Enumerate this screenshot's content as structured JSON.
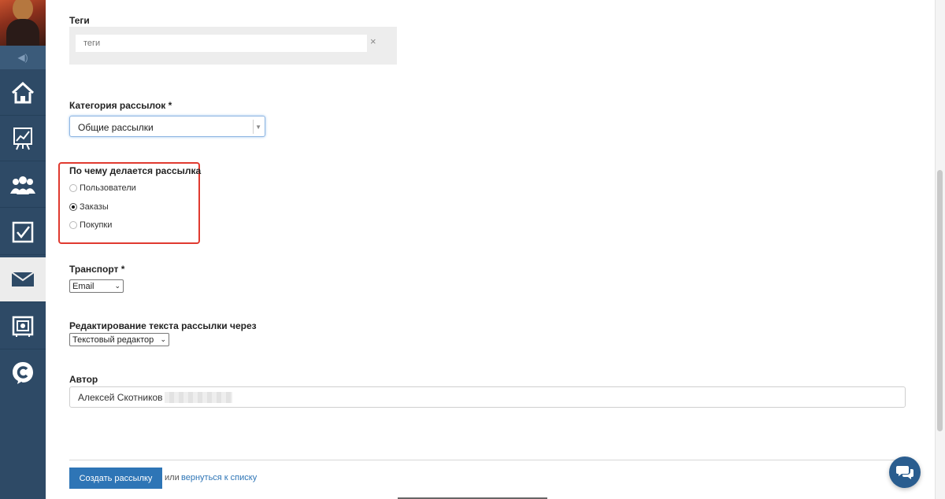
{
  "sidebar": {
    "items": [
      {
        "icon": "home-icon"
      },
      {
        "icon": "chart-board-icon"
      },
      {
        "icon": "users-icon"
      },
      {
        "icon": "checkbox-icon"
      },
      {
        "icon": "mail-icon",
        "active": true
      },
      {
        "icon": "safe-icon"
      },
      {
        "icon": "chat-c-icon"
      }
    ]
  },
  "form": {
    "tags": {
      "label": "Теги",
      "placeholder": "теги",
      "clear": "×"
    },
    "category": {
      "label": "Категория рассылок *",
      "value": "Общие рассылки",
      "arrow": "▼"
    },
    "basis": {
      "label": "По чему делается рассылка",
      "options": [
        "Пользователи",
        "Заказы",
        "Покупки"
      ],
      "selected": "Заказы"
    },
    "transport": {
      "label": "Транспорт *",
      "value": "Email",
      "chev": "⌄"
    },
    "editor": {
      "label": "Редактирование текста рассылки через",
      "value": "Текстовый редактор",
      "chev": "⌄"
    },
    "author": {
      "label": "Автор",
      "value": "Алексей Скотников"
    },
    "submit_label": "Создать рассылку",
    "or_text": "или",
    "back_link": "вернуться к списку"
  },
  "colors": {
    "sidebar": "#2e4a66",
    "accent": "#2e75b6",
    "highlight": "#e03a30"
  }
}
